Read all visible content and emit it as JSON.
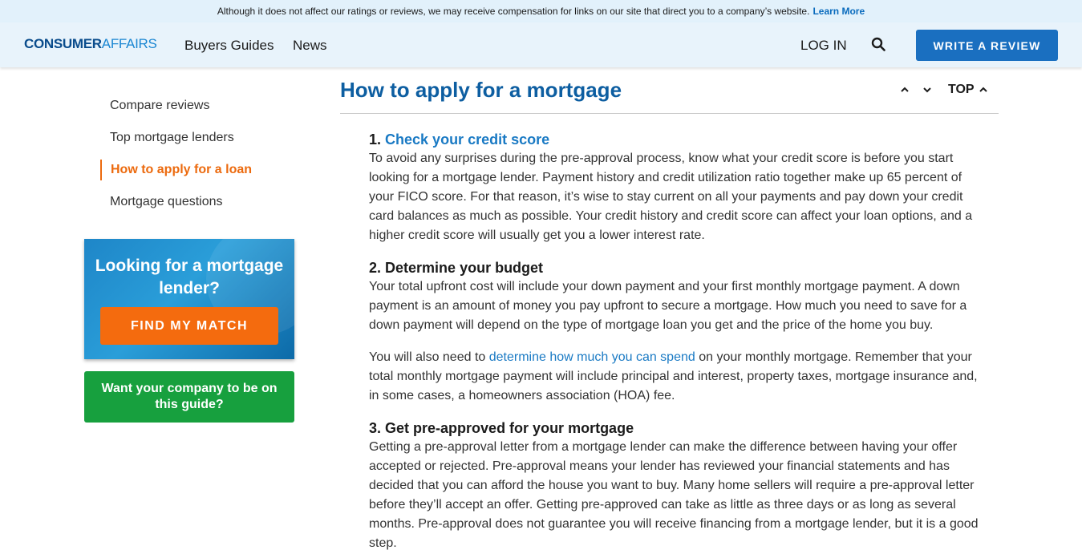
{
  "disclosure": {
    "text": "Although it does not affect our ratings or reviews, we may receive compensation for links on our site that direct you to a company’s website.",
    "link": "Learn More"
  },
  "header": {
    "logo_part1": "CONSUMER",
    "logo_part2": "AFFAIRS",
    "nav": [
      "Buyers Guides",
      "News"
    ],
    "login": "LOG IN",
    "search_icon": "search-icon",
    "write_review": "WRITE A REVIEW"
  },
  "sidebar": {
    "items": [
      {
        "label": "Compare reviews",
        "active": false
      },
      {
        "label": "Top mortgage lenders",
        "active": false
      },
      {
        "label": "How to apply for a loan",
        "active": true
      },
      {
        "label": "Mortgage questions",
        "active": false
      }
    ],
    "promo": {
      "title": "Looking for a mortgage lender?",
      "button": "FIND MY MATCH"
    },
    "company_button": "Want your company to be on this guide?"
  },
  "main": {
    "title": "How to apply for a mortgage",
    "top_label": "TOP",
    "steps": [
      {
        "number": "1.",
        "heading": "Check your credit score",
        "heading_is_link": true,
        "paragraphs": [
          "To avoid any surprises during the pre-approval process, know what your credit score is before you start looking for a mortgage lender. Payment history and credit utilization ratio together make up 65 percent of your FICO score. For that reason, it’s wise to stay current on all your payments and pay down your credit card balances as much as possible. Your credit history and credit score can affect your loan options, and a higher credit score will usually get you a lower interest rate."
        ]
      },
      {
        "number": "2.",
        "heading": "Determine your budget",
        "heading_is_link": false,
        "paragraphs": [
          "Your total upfront cost will include your down payment and your first monthly mortgage payment. A down payment is an amount of money you pay upfront to secure a mortgage. How much you need to save for a down payment will depend on the type of mortgage loan you get and the price of the home you buy."
        ],
        "para2_before": "You will also need to ",
        "para2_link": "determine how much you can spend",
        "para2_after": " on your monthly mortgage. Remember that your total monthly mortgage payment will include principal and interest, property taxes, mortgage insurance and, in some cases, a homeowners association (HOA) fee."
      },
      {
        "number": "3.",
        "heading": "Get pre-approved for your mortgage",
        "heading_is_link": false,
        "paragraphs": [
          "Getting a pre-approval letter from a mortgage lender can make the difference between having your offer accepted or rejected. Pre-approval means your lender has reviewed your financial statements and has decided that you can afford the house you want to buy. Many home sellers will require a pre-approval letter before they’ll accept an offer. Getting pre-approved can take as little as three days or as long as several months. Pre-approval does not guarantee you will receive financing from a mortgage lender, but it is a good step."
        ]
      }
    ]
  },
  "colors": {
    "brand_blue": "#1a6fc0",
    "accent_orange": "#f46b0e",
    "green": "#17a03e",
    "link_blue": "#1a7ac4"
  }
}
